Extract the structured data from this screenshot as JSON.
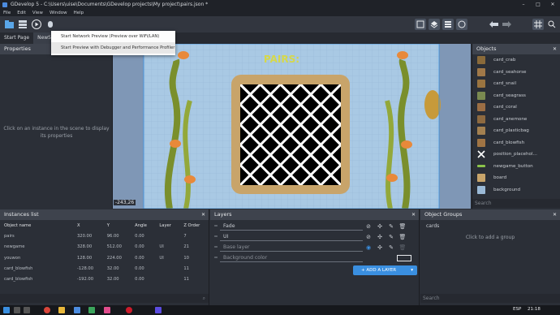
{
  "window": {
    "title": "GDevelop 5 - C:\\Users\\uise\\Documents\\GDevelop projects\\My project\\pairs.json *",
    "minimize": "–",
    "maximize": "□",
    "close": "✕"
  },
  "menu": [
    "File",
    "Edit",
    "View",
    "Window",
    "Help"
  ],
  "tabs": {
    "start_page": "Start Page",
    "newscene": "NewSc"
  },
  "dropdown": {
    "item1": "Start Network Preview (Preview over WiFi/LAN)",
    "item2": "Start Preview with Debugger and Performance Profiler"
  },
  "properties": {
    "title": "Properties",
    "message": "Click on an instance in the scene to display its properties"
  },
  "scene": {
    "pairs_text": "PAIRS:",
    "coords": "-243,26"
  },
  "objects": {
    "title": "Objects",
    "search_placeholder": "Search",
    "items": [
      {
        "name": "card_crab",
        "color": "#8a6a3a"
      },
      {
        "name": "card_seahorse",
        "color": "#a07848"
      },
      {
        "name": "card_snail",
        "color": "#9a7440"
      },
      {
        "name": "card_seagrass",
        "color": "#7a8a50"
      },
      {
        "name": "card_coral",
        "color": "#9c6e44"
      },
      {
        "name": "card_anemone",
        "color": "#8e6a40"
      },
      {
        "name": "card_plasticbag",
        "color": "#a38050"
      },
      {
        "name": "card_blowfish",
        "color": "#a07444"
      },
      {
        "name": "position_placeholder",
        "display": "position_placehol...",
        "color": "#ffffff"
      },
      {
        "name": "newgame_button",
        "color": "#8bc34a"
      },
      {
        "name": "board",
        "color": "#c8a46a"
      },
      {
        "name": "background",
        "color": "#9ab9d6"
      }
    ]
  },
  "instances": {
    "title": "Instances list",
    "headers": [
      "Object name",
      "X",
      "Y",
      "Angle",
      "Layer",
      "Z Order"
    ],
    "rows": [
      [
        "pairs",
        "320.00",
        "96.00",
        "0.00",
        "",
        "7"
      ],
      [
        "newgame",
        "328.00",
        "512.00",
        "0.00",
        "UI",
        "21"
      ],
      [
        "youwon",
        "128.00",
        "224.00",
        "0.00",
        "UI",
        "10"
      ],
      [
        "card_blowfish",
        "-128.00",
        "32.00",
        "0.00",
        "",
        "11"
      ],
      [
        "card_blowfish",
        "-192.00",
        "32.00",
        "0.00",
        "",
        "11"
      ]
    ]
  },
  "layers": {
    "title": "Layers",
    "items": [
      "Fade",
      "UI",
      "Base layer",
      "Background color"
    ],
    "add_button": "+ ADD A LAYER"
  },
  "groups": {
    "title": "Object Groups",
    "item": "cards",
    "hint": "Click to add a group",
    "search_placeholder": "Search"
  },
  "taskbar": {
    "lang": "ESP",
    "time": "21:18"
  },
  "colors": {
    "accent": "#3a8fe0",
    "panel_bg": "#2b2f37",
    "header_bg": "#3e434d"
  }
}
